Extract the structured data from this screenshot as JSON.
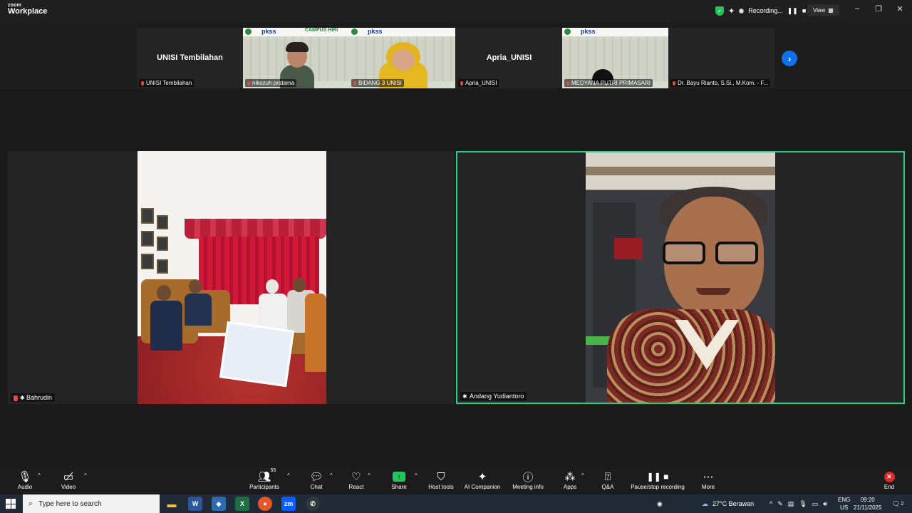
{
  "titlebar": {
    "logo_line1": "zoom",
    "logo_line2": "Workplace",
    "recording_label": "Recording...",
    "view_label": "View"
  },
  "strip": {
    "tiles": [
      {
        "center_name": "UNISI Tembilahan",
        "tag": "UNISI Tembilahan"
      },
      {
        "tag": "nikozuh pratama"
      },
      {
        "tag": "BIDANG 3 UNISI"
      },
      {
        "center_name": "Apria_UNISI",
        "tag": "Apria_UNISI"
      },
      {
        "tag": "MEDYANA PUTRI PRIMASARI"
      },
      {
        "tag": "Dr. Bayu Rianto, S.Si., M.Kom. - F..."
      }
    ],
    "banner_pkss": "pkss",
    "banner_campus": "CAMPUS HIRI"
  },
  "main": {
    "left_tile_name": "Bahrudin",
    "right_tile_name": "Andang Yudiantoro"
  },
  "toolbar": {
    "audio": "Audio",
    "video": "Video",
    "participants": "Participants",
    "participants_count": "55",
    "chat": "Chat",
    "react": "React",
    "share": "Share",
    "host_tools": "Host tools",
    "ai_companion": "AI Companion",
    "meeting_info": "Meeting info",
    "apps": "Apps",
    "qa": "Q&A",
    "pause_stop": "Pause/stop recording",
    "more": "More",
    "end": "End"
  },
  "taskbar": {
    "search_placeholder": "Type here to search",
    "weather": "27°C  Berawan",
    "lang_line1": "ENG",
    "lang_line2": "US",
    "time": "09:20",
    "date": "21/11/2025",
    "notif_count": "2"
  },
  "colors": {
    "accent_blue": "#0e72ed",
    "active_speaker": "#23d18b",
    "muted_red": "#e04a4a",
    "share_green": "#22c55e"
  }
}
